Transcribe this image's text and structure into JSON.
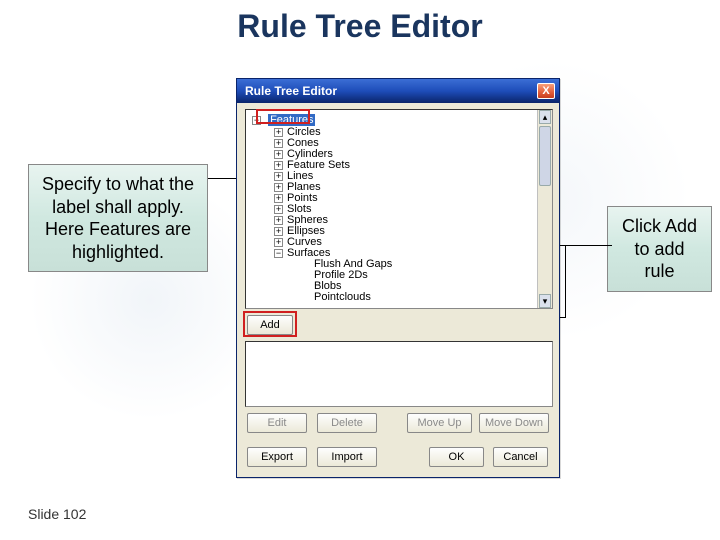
{
  "title": "Rule Tree Editor",
  "callouts": {
    "left": "Specify to what the label shall apply. Here Features are highlighted.",
    "right": "Click Add to add rule"
  },
  "dialog": {
    "title": "Rule Tree Editor",
    "close_icon": "X",
    "root_label": "Features",
    "children": [
      "Circles",
      "Cones",
      "Cylinders",
      "Feature Sets",
      "Lines",
      "Planes",
      "Points",
      "Slots",
      "Spheres",
      "Ellipses",
      "Curves",
      "Surfaces"
    ],
    "grandchildren": [
      "Flush And Gaps",
      "Profile 2Ds",
      "Blobs",
      "Pointclouds"
    ],
    "buttons": {
      "add": "Add",
      "edit": "Edit",
      "delete": "Delete",
      "move_up": "Move Up",
      "move_down": "Move Down",
      "export": "Export",
      "import": "Import",
      "ok": "OK",
      "cancel": "Cancel"
    }
  },
  "slide_number": "Slide 102"
}
